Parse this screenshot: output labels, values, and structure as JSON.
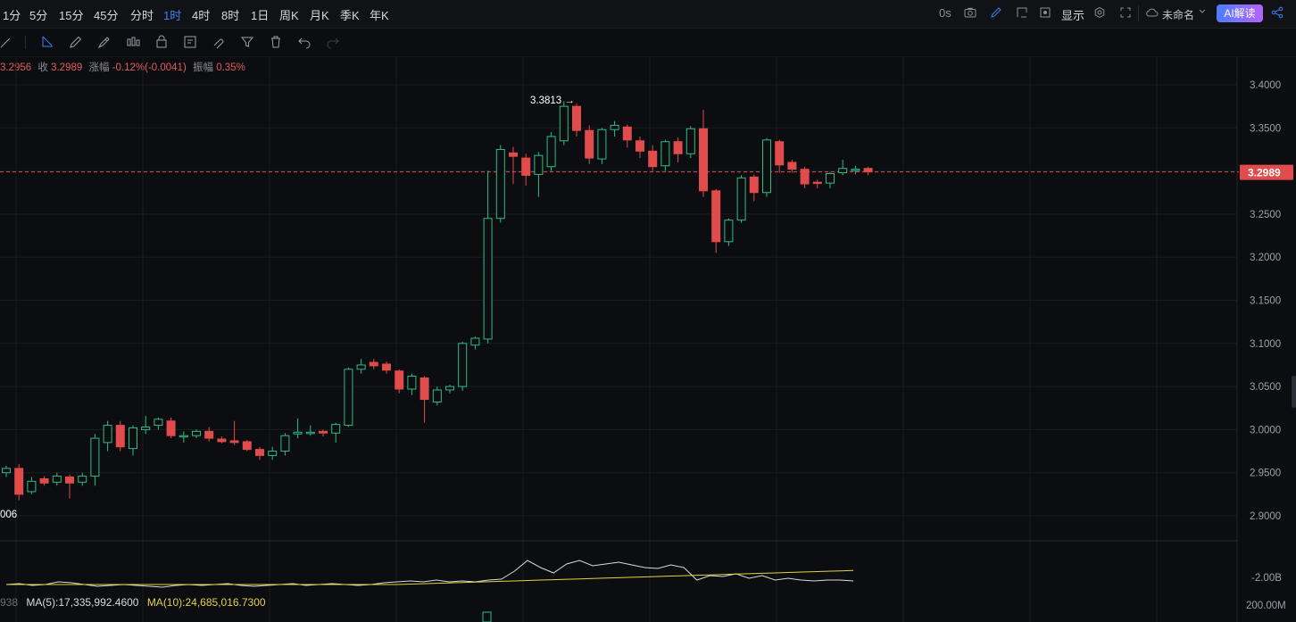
{
  "timeframes": [
    {
      "label": "1分",
      "active": false
    },
    {
      "label": "5分",
      "active": false
    },
    {
      "label": "15分",
      "active": false
    },
    {
      "label": "45分",
      "active": false
    },
    {
      "label": "分时",
      "active": false
    },
    {
      "label": "1时",
      "active": true
    },
    {
      "label": "4时",
      "active": false
    },
    {
      "label": "8时",
      "active": false
    },
    {
      "label": "1日",
      "active": false
    },
    {
      "label": "周K",
      "active": false
    },
    {
      "label": "月K",
      "active": false
    },
    {
      "label": "季K",
      "active": false
    },
    {
      "label": "年K",
      "active": false
    }
  ],
  "topright": {
    "countdown": "0s",
    "display_label": "显示",
    "layout_name": "未命名",
    "ai_label": "AI解读"
  },
  "ohlc": {
    "open_partial": "3.2956",
    "close_label": "收",
    "close_value": "3.2989",
    "change_label": "涨幅",
    "change_value": "-0.12%(-0.0041)",
    "amplitude_label": "振幅",
    "amplitude_value": "0.35%"
  },
  "chart_data": {
    "type": "candlestick",
    "price_axis_ticks": [
      "3.4000",
      "3.3500",
      "3.3000",
      "3.2500",
      "3.2000",
      "3.1500",
      "3.1000",
      "3.0500",
      "3.0000",
      "2.9500",
      "2.9000"
    ],
    "current_price": "3.2989",
    "high_marker": "3.3813",
    "low_marker_partial": "006",
    "colors": {
      "up": "#2ebd85",
      "down": "#e04b4b",
      "ma5": "#d9d9d9",
      "ma10": "#e6cf45",
      "price_line": "#e04b4b"
    },
    "candles": [
      [
        2.95,
        2.955,
        2.945,
        2.958
      ],
      [
        2.955,
        2.925,
        2.918,
        2.96
      ],
      [
        2.928,
        2.94,
        2.925,
        2.945
      ],
      [
        2.943,
        2.938,
        2.935,
        2.946
      ],
      [
        2.939,
        2.946,
        2.935,
        2.95
      ],
      [
        2.945,
        2.938,
        2.92,
        2.948
      ],
      [
        2.939,
        2.946,
        2.935,
        2.95
      ],
      [
        2.946,
        2.99,
        2.935,
        2.995
      ],
      [
        2.985,
        3.005,
        2.975,
        3.01
      ],
      [
        3.005,
        2.98,
        2.975,
        3.01
      ],
      [
        2.978,
        3.002,
        2.97,
        3.005
      ],
      [
        3.0,
        3.003,
        2.995,
        3.016
      ],
      [
        3.005,
        3.012,
        3.0,
        3.014
      ],
      [
        3.01,
        2.993,
        2.99,
        3.014
      ],
      [
        2.992,
        2.993,
        2.985,
        2.998
      ],
      [
        2.993,
        2.998,
        2.99,
        3.0
      ],
      [
        2.998,
        2.99,
        2.986,
        3.003
      ],
      [
        2.989,
        2.986,
        2.984,
        2.992
      ],
      [
        2.987,
        2.985,
        2.982,
        3.01
      ],
      [
        2.986,
        2.977,
        2.975,
        2.988
      ],
      [
        2.977,
        2.97,
        2.965,
        2.98
      ],
      [
        2.97,
        2.975,
        2.965,
        2.98
      ],
      [
        2.975,
        2.993,
        2.97,
        2.996
      ],
      [
        2.995,
        2.997,
        2.99,
        3.013
      ],
      [
        2.997,
        2.997,
        2.993,
        3.005
      ],
      [
        2.998,
        2.996,
        2.992,
        3.0
      ],
      [
        2.996,
        3.006,
        2.985,
        3.008
      ],
      [
        3.005,
        3.07,
        3.003,
        3.072
      ],
      [
        3.07,
        3.075,
        3.065,
        3.082
      ],
      [
        3.078,
        3.074,
        3.07,
        3.082
      ],
      [
        3.076,
        3.069,
        3.065,
        3.079
      ],
      [
        3.068,
        3.047,
        3.042,
        3.07
      ],
      [
        3.047,
        3.062,
        3.04,
        3.065
      ],
      [
        3.06,
        3.035,
        3.008,
        3.062
      ],
      [
        3.032,
        3.046,
        3.028,
        3.05
      ],
      [
        3.046,
        3.05,
        3.042,
        3.052
      ],
      [
        3.05,
        3.1,
        3.045,
        3.102
      ],
      [
        3.098,
        3.106,
        3.093,
        3.108
      ],
      [
        3.105,
        3.245,
        3.1,
        3.3
      ],
      [
        3.245,
        3.325,
        3.24,
        3.33
      ],
      [
        3.321,
        3.317,
        3.285,
        3.328
      ],
      [
        3.315,
        3.295,
        3.283,
        3.32
      ],
      [
        3.296,
        3.318,
        3.27,
        3.322
      ],
      [
        3.305,
        3.34,
        3.3,
        3.345
      ],
      [
        3.335,
        3.375,
        3.33,
        3.381
      ],
      [
        3.375,
        3.347,
        3.34,
        3.378
      ],
      [
        3.347,
        3.315,
        3.308,
        3.353
      ],
      [
        3.314,
        3.348,
        3.308,
        3.35
      ],
      [
        3.348,
        3.353,
        3.34,
        3.358
      ],
      [
        3.351,
        3.336,
        3.327,
        3.354
      ],
      [
        3.335,
        3.323,
        3.315,
        3.34
      ],
      [
        3.323,
        3.305,
        3.3,
        3.33
      ],
      [
        3.306,
        3.334,
        3.3,
        3.336
      ],
      [
        3.334,
        3.32,
        3.31,
        3.339
      ],
      [
        3.32,
        3.349,
        3.315,
        3.352
      ],
      [
        3.349,
        3.277,
        3.27,
        3.371
      ],
      [
        3.277,
        3.218,
        3.205,
        3.279
      ],
      [
        3.218,
        3.243,
        3.213,
        3.245
      ],
      [
        3.243,
        3.292,
        3.24,
        3.295
      ],
      [
        3.293,
        3.275,
        3.265,
        3.296
      ],
      [
        3.275,
        3.336,
        3.27,
        3.338
      ],
      [
        3.334,
        3.307,
        3.298,
        3.336
      ],
      [
        3.31,
        3.302,
        3.298,
        3.313
      ],
      [
        3.302,
        3.285,
        3.28,
        3.305
      ],
      [
        3.287,
        3.286,
        3.28,
        3.29
      ],
      [
        3.286,
        3.297,
        3.28,
        3.299
      ],
      [
        3.298,
        3.303,
        3.295,
        3.313
      ],
      [
        3.302,
        3.302,
        3.296,
        3.306
      ],
      [
        3.303,
        3.299,
        3.295,
        3.305
      ]
    ],
    "indicator": {
      "right_label": "-2.00B",
      "bottom_label": "200.00M",
      "ma5_label": "MA(5):17,335,992.4600",
      "ma10_label": "MA(10):24,685,016.7300",
      "left_partial": "938"
    }
  }
}
